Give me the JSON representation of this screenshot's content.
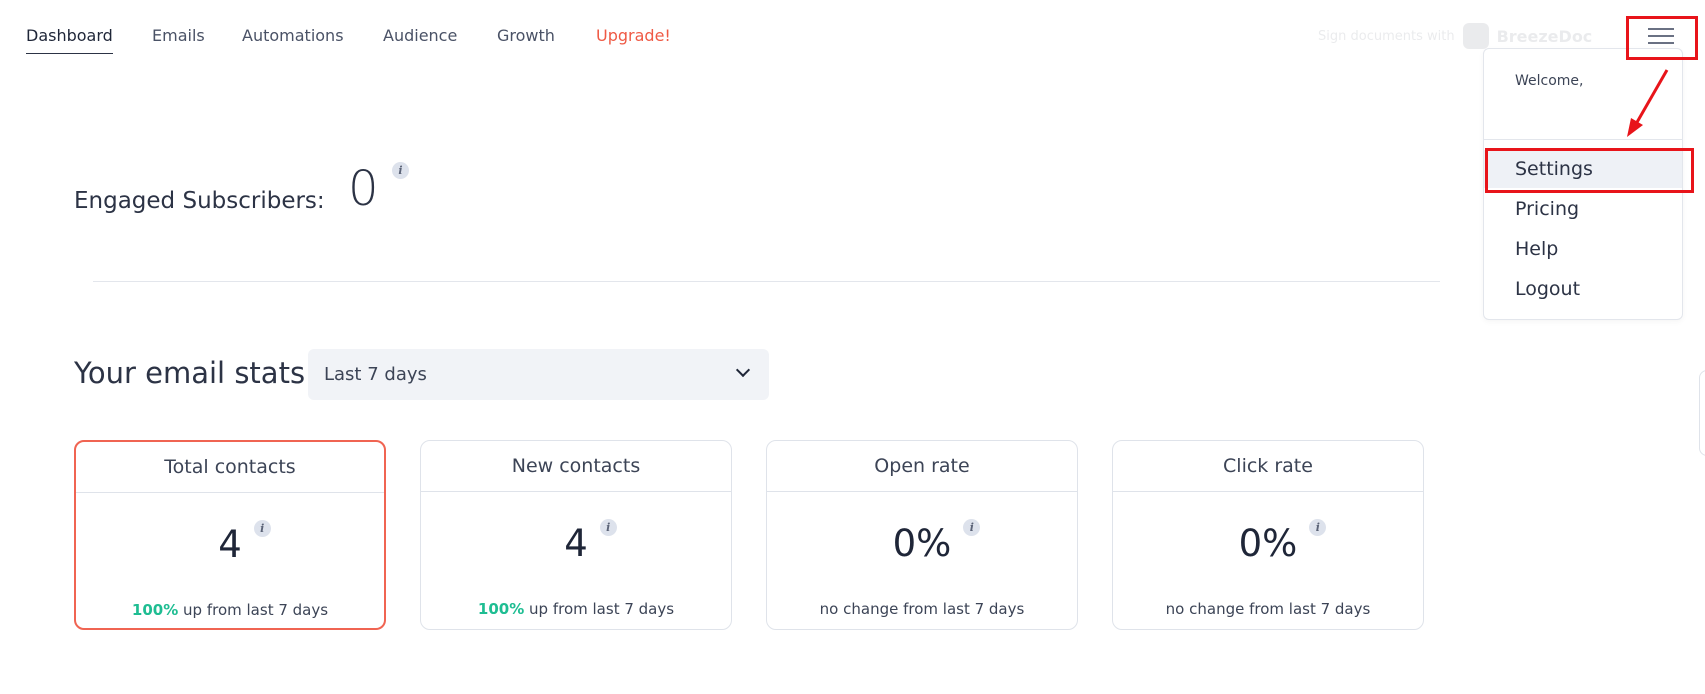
{
  "nav": {
    "tabs": [
      {
        "label": "Dashboard",
        "active": true
      },
      {
        "label": "Emails"
      },
      {
        "label": "Automations"
      },
      {
        "label": "Audience"
      },
      {
        "label": "Growth"
      },
      {
        "label": "Upgrade!",
        "color": "#ef5a45"
      }
    ],
    "promo": {
      "text": "Sign documents with",
      "brand": "BreezeDoc"
    }
  },
  "menu": {
    "welcome": "Welcome,",
    "items": [
      {
        "label": "Settings",
        "highlighted": true
      },
      {
        "label": "Pricing"
      },
      {
        "label": "Help"
      },
      {
        "label": "Logout"
      }
    ]
  },
  "engaged": {
    "label": "Engaged Subscribers:",
    "value": "0"
  },
  "stats": {
    "title": "Your email stats",
    "range": "Last 7 days",
    "cards": [
      {
        "title": "Total contacts",
        "value": "4",
        "change": "100%",
        "change_text": "up from last 7 days",
        "selected": true
      },
      {
        "title": "New contacts",
        "value": "4",
        "change": "100%",
        "change_text": "up from last 7 days"
      },
      {
        "title": "Open rate",
        "value": "0%",
        "change": "",
        "change_text": "no change from last 7 days"
      },
      {
        "title": "Click rate",
        "value": "0%",
        "change": "",
        "change_text": "no change from last 7 days"
      }
    ]
  },
  "icons": {
    "info": "i"
  },
  "colors": {
    "accent": "#ef5a45",
    "positive": "#1ebd92",
    "annotation": "#e8141a",
    "selected_border": "#f06452"
  }
}
